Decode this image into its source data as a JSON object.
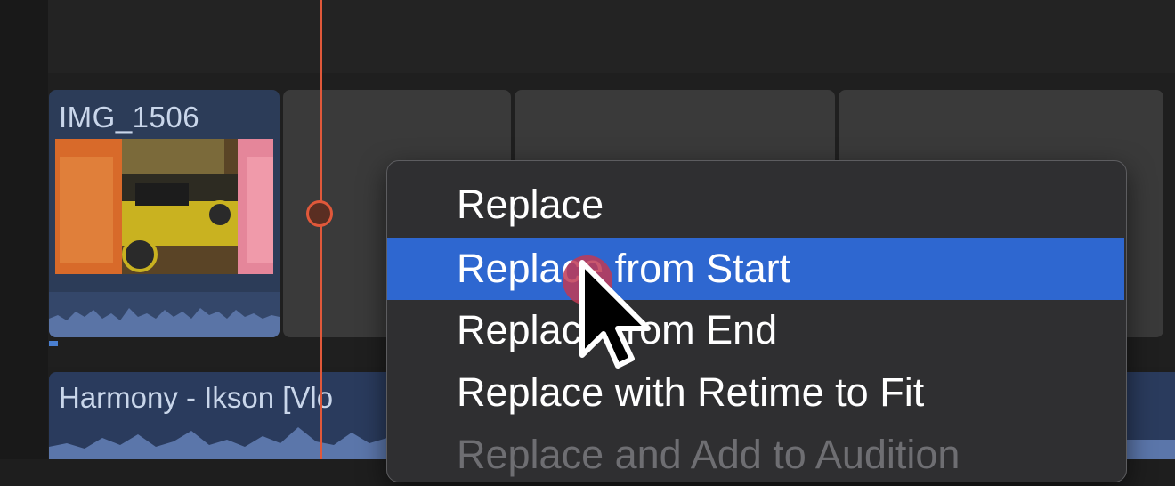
{
  "timeline": {
    "video_clip": {
      "name": "IMG_1506"
    },
    "audio_clip": {
      "name": "Harmony - Ikson [Vlo"
    }
  },
  "context_menu": {
    "items": [
      {
        "label": "Replace",
        "state": "normal"
      },
      {
        "label": "Replace from Start",
        "state": "highlighted"
      },
      {
        "label": "Replace from End",
        "state": "normal"
      },
      {
        "label": "Replace with Retime to Fit",
        "state": "normal"
      },
      {
        "label": "Replace and Add to Audition",
        "state": "disabled"
      }
    ]
  },
  "colors": {
    "playhead": "#e0583a",
    "menu_highlight": "#2e67d0",
    "clip_blue": "#2c3c58",
    "gap_gray": "#3a3a3a"
  },
  "icons": {
    "cursor": "arrow-cursor-icon",
    "playhead": "playhead-icon"
  }
}
